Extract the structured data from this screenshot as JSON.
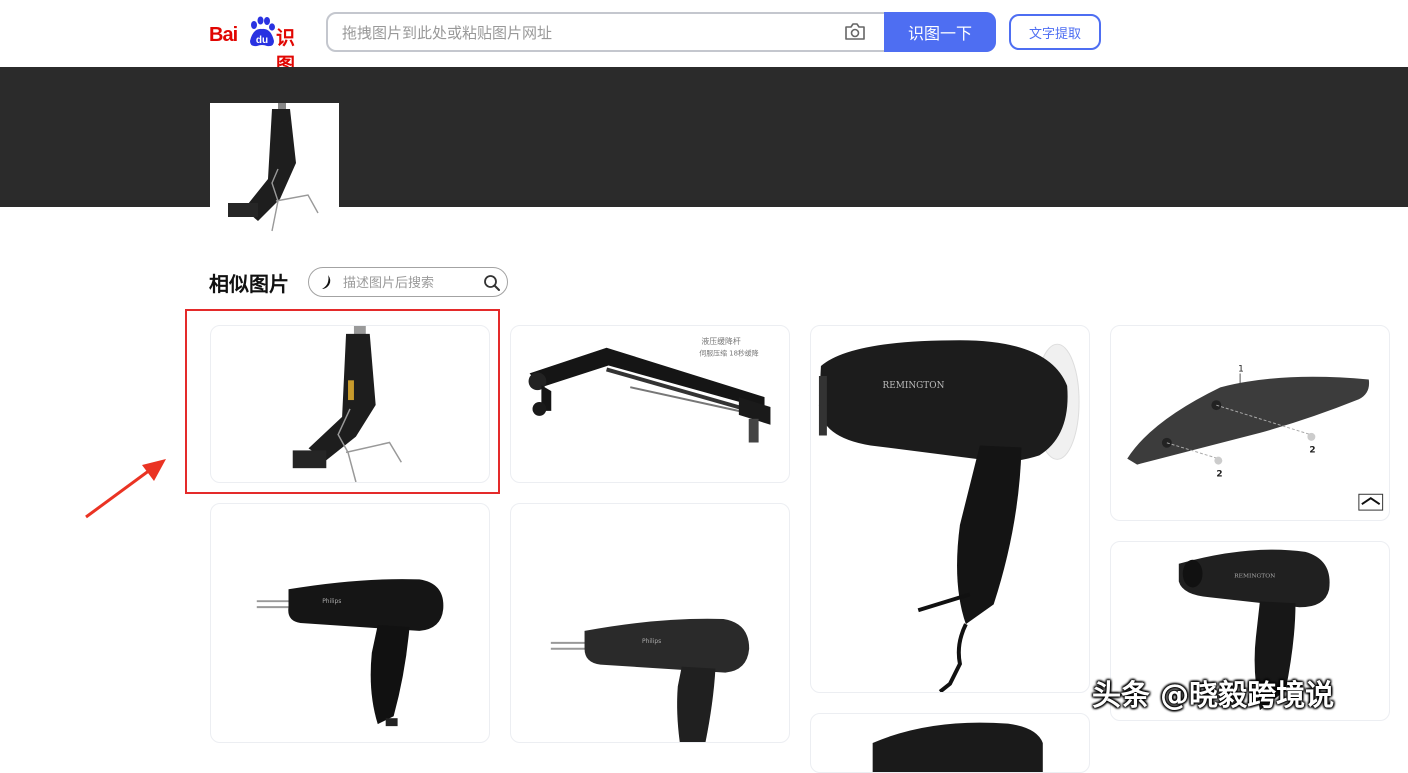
{
  "header": {
    "logo": {
      "bai": "Bai",
      "du": "du",
      "shitu": "识图"
    },
    "search": {
      "placeholder": "拖拽图片到此处或粘贴图片网址",
      "value": ""
    },
    "search_button_label": "识图一下",
    "text_extract_label": "文字提取"
  },
  "results": {
    "section_title": "相似图片",
    "describe_search_placeholder": "描述图片后搜索",
    "items": [
      {
        "desc": "black heat gun with wire stand",
        "image_text": ""
      },
      {
        "desc": "hydraulic support rod",
        "image_text": "液压缓降杆 伺服压缩 18秒缓降"
      },
      {
        "desc": "black hair dryer",
        "image_text": "REMINGTON"
      },
      {
        "desc": "black plastic part diagram",
        "image_text": "1 2 2"
      },
      {
        "desc": "black hair dryer",
        "image_text": "Philips"
      },
      {
        "desc": "black hair dryer",
        "image_text": "Philips"
      },
      {
        "desc": "black hair dryer",
        "image_text": "REMINGTON"
      },
      {
        "desc": "black hair dryer",
        "image_text": ""
      }
    ]
  },
  "annotation": {
    "highlight_color": "#e42a2a"
  },
  "watermark": "头条 @晓毅跨境说",
  "colors": {
    "brand_blue": "#4e6ef2",
    "logo_red": "#e10602",
    "banner": "#2b2b2b"
  }
}
